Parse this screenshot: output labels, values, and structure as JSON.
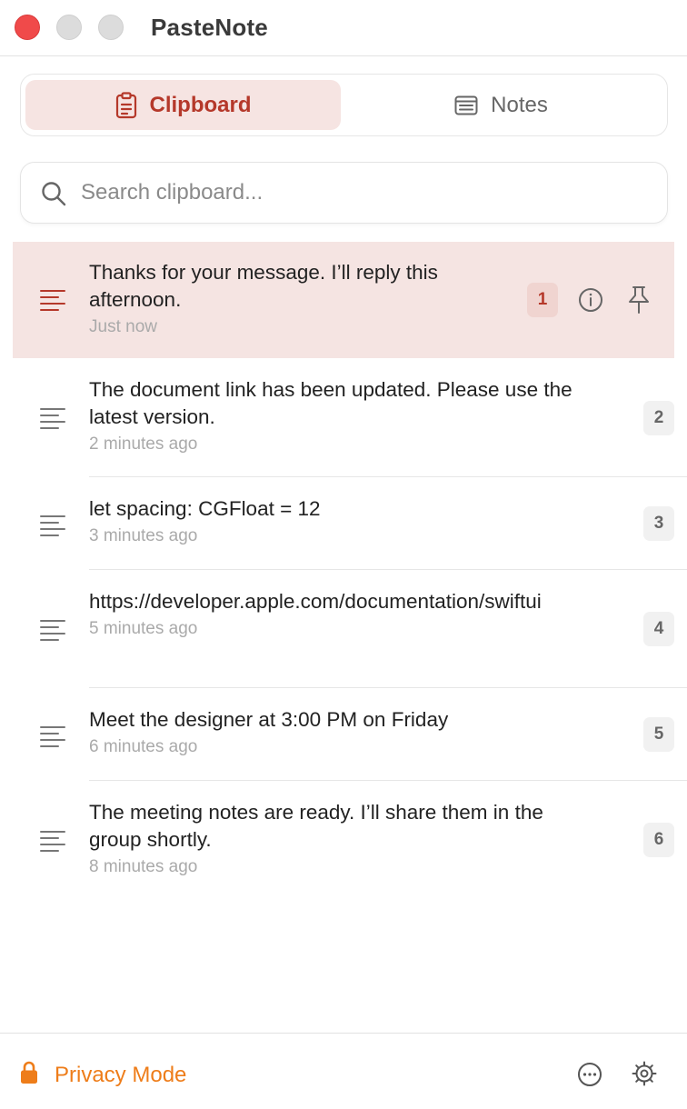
{
  "window": {
    "title": "PasteNote"
  },
  "tabs": [
    {
      "label": "Clipboard",
      "icon": "clipboard-icon",
      "selected": true
    },
    {
      "label": "Notes",
      "icon": "notes-icon",
      "selected": false
    }
  ],
  "search": {
    "placeholder": "Search clipboard...",
    "value": ""
  },
  "items": [
    {
      "text": "Thanks for your message. I’ll reply this afternoon.",
      "time": "Just now",
      "index": "1",
      "selected": true
    },
    {
      "text": "The document link has been updated. Please use the latest version.",
      "time": "2 minutes ago",
      "index": "2"
    },
    {
      "text": "let spacing: CGFloat = 12",
      "time": "3 minutes ago",
      "index": "3"
    },
    {
      "text": "https://developer.apple.com/documentation/swiftui",
      "time": "5 minutes ago",
      "index": "4"
    },
    {
      "text": "Meet the designer at 3:00 PM on Friday",
      "time": "6 minutes ago",
      "index": "5"
    },
    {
      "text": "The meeting notes are ready. I’ll share them in the group shortly.",
      "time": "8 minutes ago",
      "index": "6"
    }
  ],
  "footer": {
    "privacy_label": "Privacy Mode"
  },
  "colors": {
    "accent": "#b5382a",
    "selected_bg": "#f5e4e2",
    "privacy": "#ee7d1a",
    "close_button": "#f04a4a"
  }
}
